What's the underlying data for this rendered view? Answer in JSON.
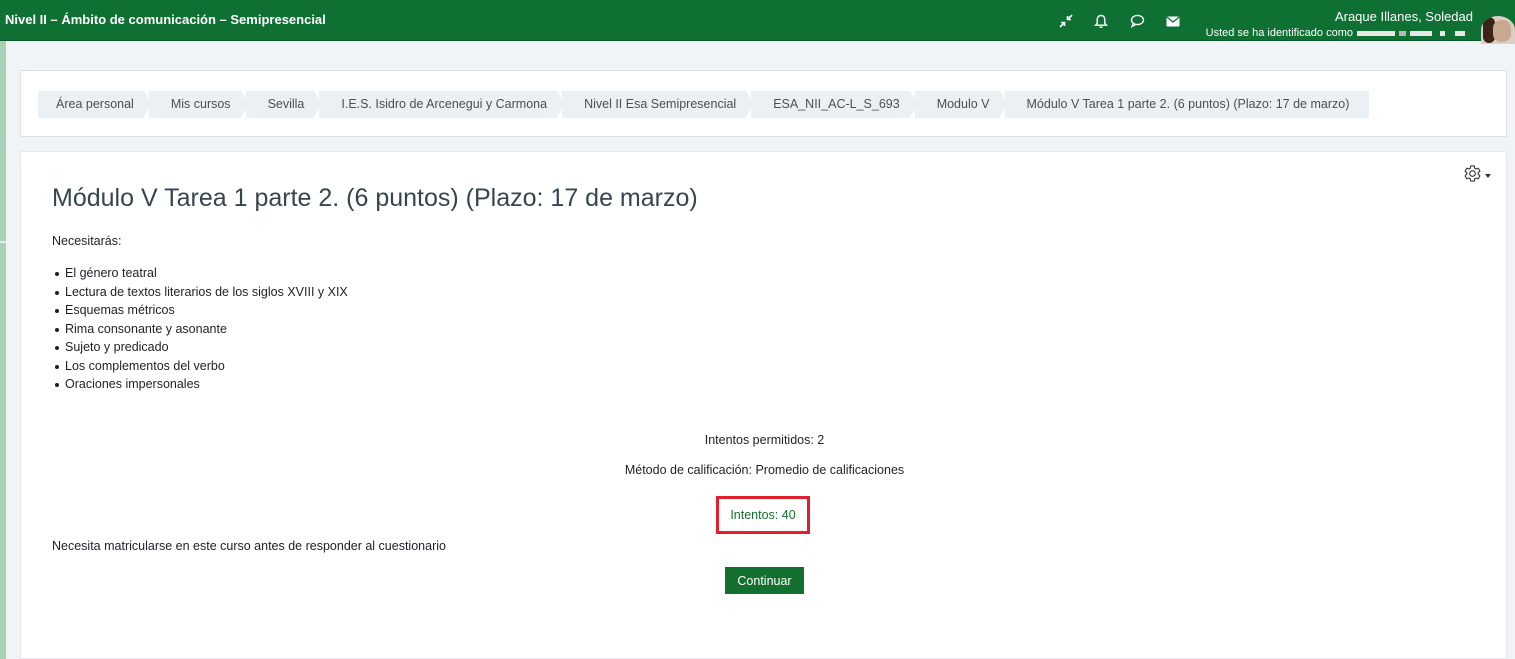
{
  "header": {
    "course_title": "Nivel II – Ámbito de comunicación – Semipresencial",
    "icons": [
      "collapse-icon",
      "bell-icon",
      "chat-icon",
      "envelope-icon"
    ],
    "user_name": "Araque Illanes, Soledad",
    "login_text": "Usted se ha identificado como"
  },
  "breadcrumb": [
    "Área personal",
    "Mis cursos",
    "Sevilla",
    "I.E.S. Isidro de Arcenegui y Carmona",
    "Nivel II Esa Semipresencial",
    "ESA_NII_AC-L_S_693",
    "Modulo V",
    "Módulo V Tarea 1 parte 2. (6 puntos) (Plazo: 17 de marzo)"
  ],
  "main": {
    "title": "Módulo V Tarea 1 parte 2. (6 puntos) (Plazo: 17 de marzo)",
    "intro": "Necesitarás:",
    "topics": [
      "El género teatral",
      "Lectura de textos literarios de los siglos XVIII y XIX",
      "Esquemas métricos",
      "Rima consonante y asonante",
      "Sujeto y predicado",
      "Los complementos del verbo",
      "Oraciones impersonales"
    ],
    "attempts_allowed": "Intentos permitidos: 2",
    "grading_method": "Método de calificación: Promedio de calificaciones",
    "attempts": "Intentos: 40",
    "enrol_message": "Necesita matricularse en este curso antes de responder al cuestionario",
    "continue_label": "Continuar"
  },
  "colors": {
    "navbar": "#0f7034",
    "accent": "#14702f",
    "highlight_border": "#e0202a"
  }
}
